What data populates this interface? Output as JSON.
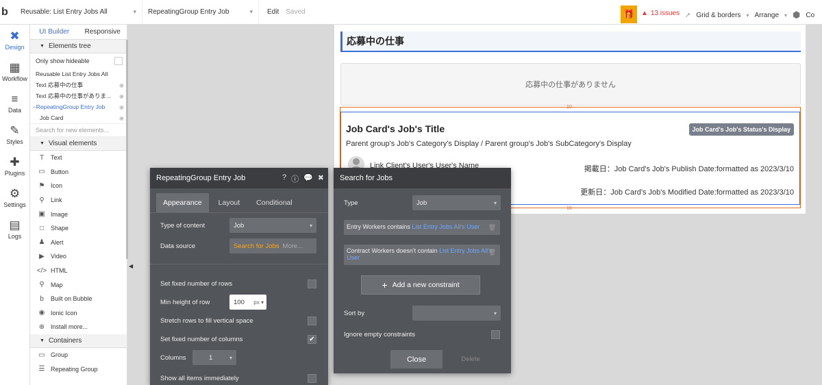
{
  "topbar": {
    "logo": "b",
    "page_select": "Reusable: List Entry Jobs All",
    "element_select": "RepeatingGroup Entry Job",
    "edit": "Edit",
    "saved": "Saved",
    "issues": "13 issues",
    "grid": "Grid & borders",
    "arrange": "Arrange",
    "co": "Co"
  },
  "nav": [
    {
      "label": "Design",
      "icon": "✖"
    },
    {
      "label": "Workflow",
      "icon": "▦"
    },
    {
      "label": "Data",
      "icon": "≡"
    },
    {
      "label": "Styles",
      "icon": "✎"
    },
    {
      "label": "Plugins",
      "icon": "✚"
    },
    {
      "label": "Settings",
      "icon": "⚙"
    },
    {
      "label": "Logs",
      "icon": "▤"
    }
  ],
  "panel": {
    "tab_ui": "UI Builder",
    "tab_resp": "Responsive",
    "elements_tree": "Elements tree",
    "only_hideable": "Only show hideable",
    "tree": [
      "Reusable List Entry Jobs All",
      "Text 応募中の仕事",
      "Text 応募中の仕事がありま...",
      "RepeatingGroup Entry Job",
      "Job Card"
    ],
    "search_placeholder": "Search for new elements...",
    "visual_elements": "Visual elements",
    "visual": [
      {
        "label": "Text",
        "icon": "T"
      },
      {
        "label": "Button",
        "icon": "▭"
      },
      {
        "label": "Icon",
        "icon": "⚑"
      },
      {
        "label": "Link",
        "icon": "⚲"
      },
      {
        "label": "Image",
        "icon": "▣"
      },
      {
        "label": "Shape",
        "icon": "□"
      },
      {
        "label": "Alert",
        "icon": "♟"
      },
      {
        "label": "Video",
        "icon": "▶"
      },
      {
        "label": "HTML",
        "icon": "</>"
      },
      {
        "label": "Map",
        "icon": "⚲"
      },
      {
        "label": "Built on Bubble",
        "icon": "b"
      },
      {
        "label": "Ionic Icon",
        "icon": "◉"
      },
      {
        "label": "Install more...",
        "icon": "⊕"
      }
    ],
    "containers": "Containers",
    "container_items": [
      {
        "label": "Group",
        "icon": "▭"
      },
      {
        "label": "Repeating Group",
        "icon": "☰"
      }
    ]
  },
  "page": {
    "header": "応募中の仕事",
    "empty": "応募中の仕事がありません",
    "marker_top": "10",
    "marker_bottom": "10",
    "card_title": "Job Card's Job's Title",
    "card_status": "Job Card's Job's Status's Display",
    "card_category": "Parent group's Job's Category's Display  /  Parent group's Job's SubCategory's Display",
    "card_user": "Link Client's User's User's Name",
    "card_publish": "掲載日：Job Card's Job's Publish Date:formatted as 2023/3/10",
    "card_modified": "更新日：Job Card's Job's Modified Date:formatted as 2023/3/10"
  },
  "props": {
    "title": "RepeatingGroup Entry Job",
    "tabs": [
      "Appearance",
      "Layout",
      "Conditional"
    ],
    "type_label": "Type of content",
    "type_value": "Job",
    "source_label": "Data source",
    "source_value": "Search for Jobs",
    "source_more": "More...",
    "fixed_rows": "Set fixed number of rows",
    "min_height_label": "Min height of row",
    "min_height_value": "100",
    "min_height_unit": "px",
    "stretch": "Stretch rows to fill vertical space",
    "fixed_cols": "Set fixed number of columns",
    "columns_label": "Columns",
    "columns_value": "1",
    "show_all": "Show all items immediately"
  },
  "search": {
    "title": "Search for Jobs",
    "type_label": "Type",
    "type_value": "Job",
    "c1_text": "Entry Workers contains",
    "c1_link": "List Entry Jobs All's User",
    "c2_text": "Contract Workers doesn't contain",
    "c2_link": "List Entry Jobs All's User",
    "add": "Add a new constraint",
    "sort_label": "Sort by",
    "ignore": "Ignore empty constraints",
    "close": "Close",
    "delete": "Delete"
  }
}
